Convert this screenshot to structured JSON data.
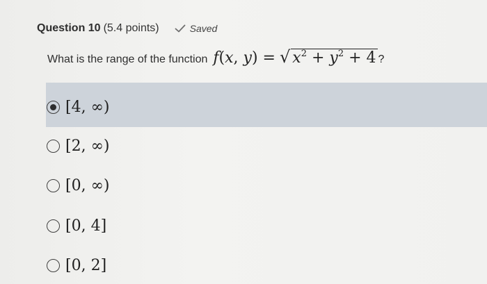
{
  "question": {
    "title": "Question 10",
    "points": "(5.4 points)",
    "status": "Saved",
    "prompt": "What is the range of the function",
    "function_lhs": "f(x, y) =",
    "function_radicand": "x2 + y2 + 4",
    "question_mark": "?"
  },
  "options": [
    {
      "label": "[4, ∞)",
      "selected": true
    },
    {
      "label": "[2, ∞)",
      "selected": false
    },
    {
      "label": "[0, ∞)",
      "selected": false
    },
    {
      "label": "[0, 4]",
      "selected": false
    },
    {
      "label": "[0, 2]",
      "selected": false
    }
  ],
  "colors": {
    "selected_band": "#cdd3da",
    "background": "#efefed"
  }
}
